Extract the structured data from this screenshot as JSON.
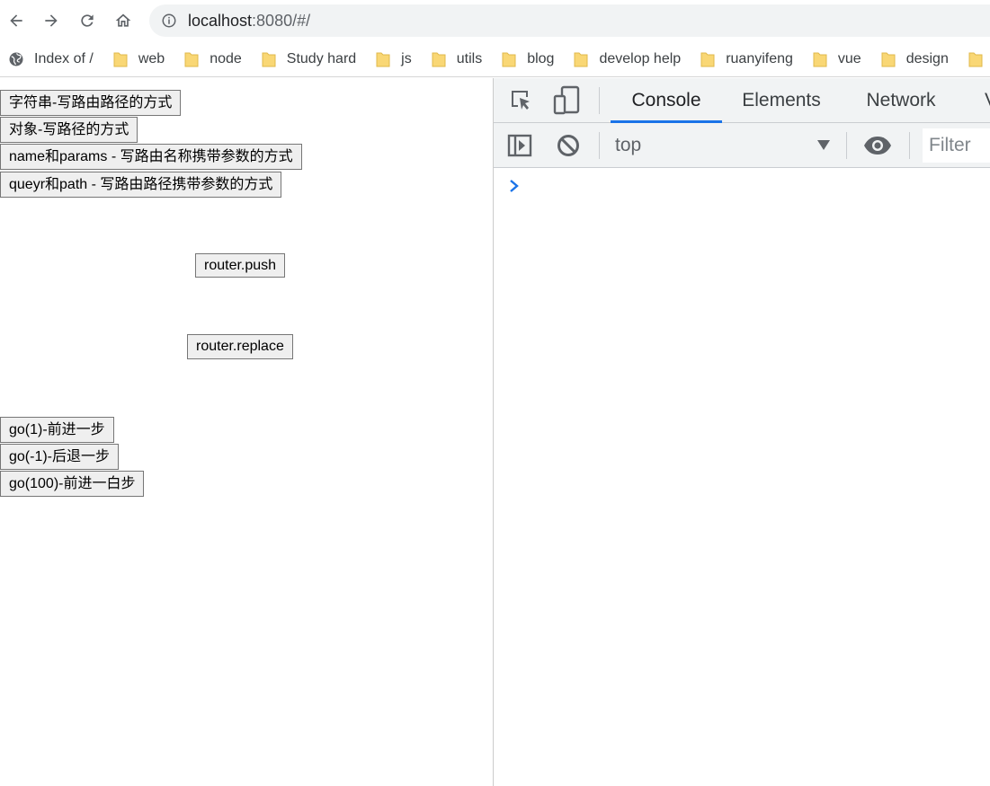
{
  "browser": {
    "url_host": "localhost",
    "url_rest": ":8080/#/",
    "bookmarks": [
      {
        "label": "Index of /",
        "icon": "globe-icon"
      },
      {
        "label": "web",
        "icon": "folder-icon"
      },
      {
        "label": "node",
        "icon": "folder-icon"
      },
      {
        "label": "Study hard",
        "icon": "folder-icon"
      },
      {
        "label": "js",
        "icon": "folder-icon"
      },
      {
        "label": "utils",
        "icon": "folder-icon"
      },
      {
        "label": "blog",
        "icon": "folder-icon"
      },
      {
        "label": "develop help",
        "icon": "folder-icon"
      },
      {
        "label": "ruanyifeng",
        "icon": "folder-icon"
      },
      {
        "label": "vue",
        "icon": "folder-icon"
      },
      {
        "label": "design",
        "icon": "folder-icon"
      }
    ]
  },
  "page": {
    "buttons": {
      "string_path": "字符串-写路由路径的方式",
      "object_path": "对象-写路径的方式",
      "name_params": "name和params - 写路由名称携带参数的方式",
      "query_path": "queyr和path - 写路由路径携带参数的方式",
      "router_push": "router.push",
      "router_replace": "router.replace",
      "go_forward": "go(1)-前进一步",
      "go_back": "go(-1)-后退一步",
      "go_100": "go(100)-前进一白步"
    }
  },
  "devtools": {
    "tabs": {
      "console": "Console",
      "elements": "Elements",
      "network": "Network",
      "partial": "V"
    },
    "active_tab": "Console",
    "context": "top",
    "filter_placeholder": "Filter"
  },
  "colors": {
    "accent": "#1a73e8",
    "folder": "#f9d775",
    "prompt": "#1a73e8"
  }
}
